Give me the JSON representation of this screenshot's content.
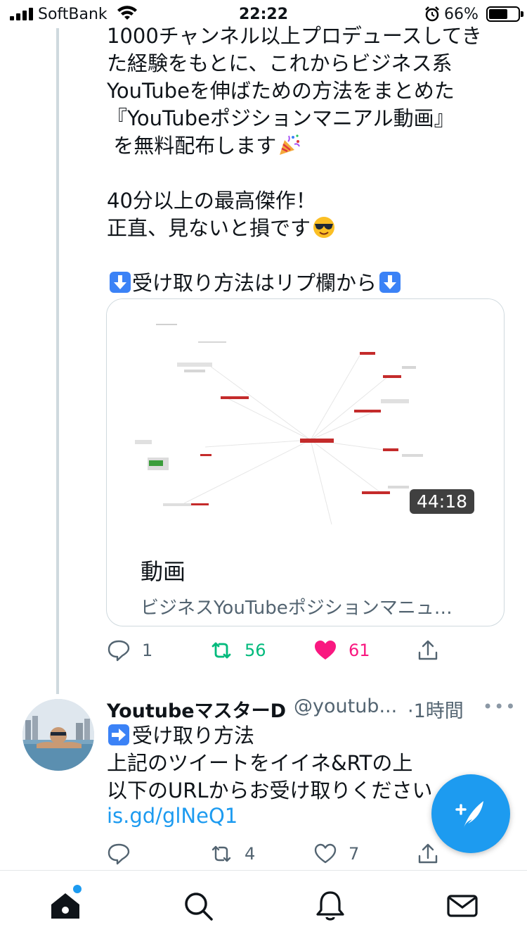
{
  "status_bar": {
    "carrier": "SoftBank",
    "time": "22:22",
    "battery_percent": "66%",
    "battery_level": 0.66
  },
  "tweet1": {
    "text": "1000チャンネル以上プロデュースしてき\nた経験をもとに、これからビジネス系\nYouTubeを伸ばための方法をまとめた\n『YouTubeポジションマニアル動画』\n を無料配布します",
    "text2": "40分以上の最高傑作！\n正直、見ないと損です",
    "text3": "受け取り方法はリプ欄から",
    "card": {
      "duration": "44:18",
      "title": "動画",
      "subtitle": "ビジネスYouTubeポジションマニュ…"
    },
    "actions": {
      "reply_count": "1",
      "retweet_count": "56",
      "like_count": "61"
    },
    "colors": {
      "retweeted": "#00ba7c",
      "liked": "#f91880"
    }
  },
  "tweet2": {
    "name": "YoutubeマスターD",
    "handle": "@youtub...",
    "time": "·1時間",
    "more": "•••",
    "text": "受け取り方法\n上記のツイートをイイネ&RTの上\n以下のURLからお受け取りください",
    "link": "is.gd/glNeQ1",
    "actions": {
      "retweet_count": "4",
      "like_count": "7"
    }
  },
  "bottom_nav": {
    "items": [
      "home-icon",
      "search-icon",
      "notifications-icon",
      "messages-icon"
    ]
  },
  "accent_color": "#1d9bf0"
}
